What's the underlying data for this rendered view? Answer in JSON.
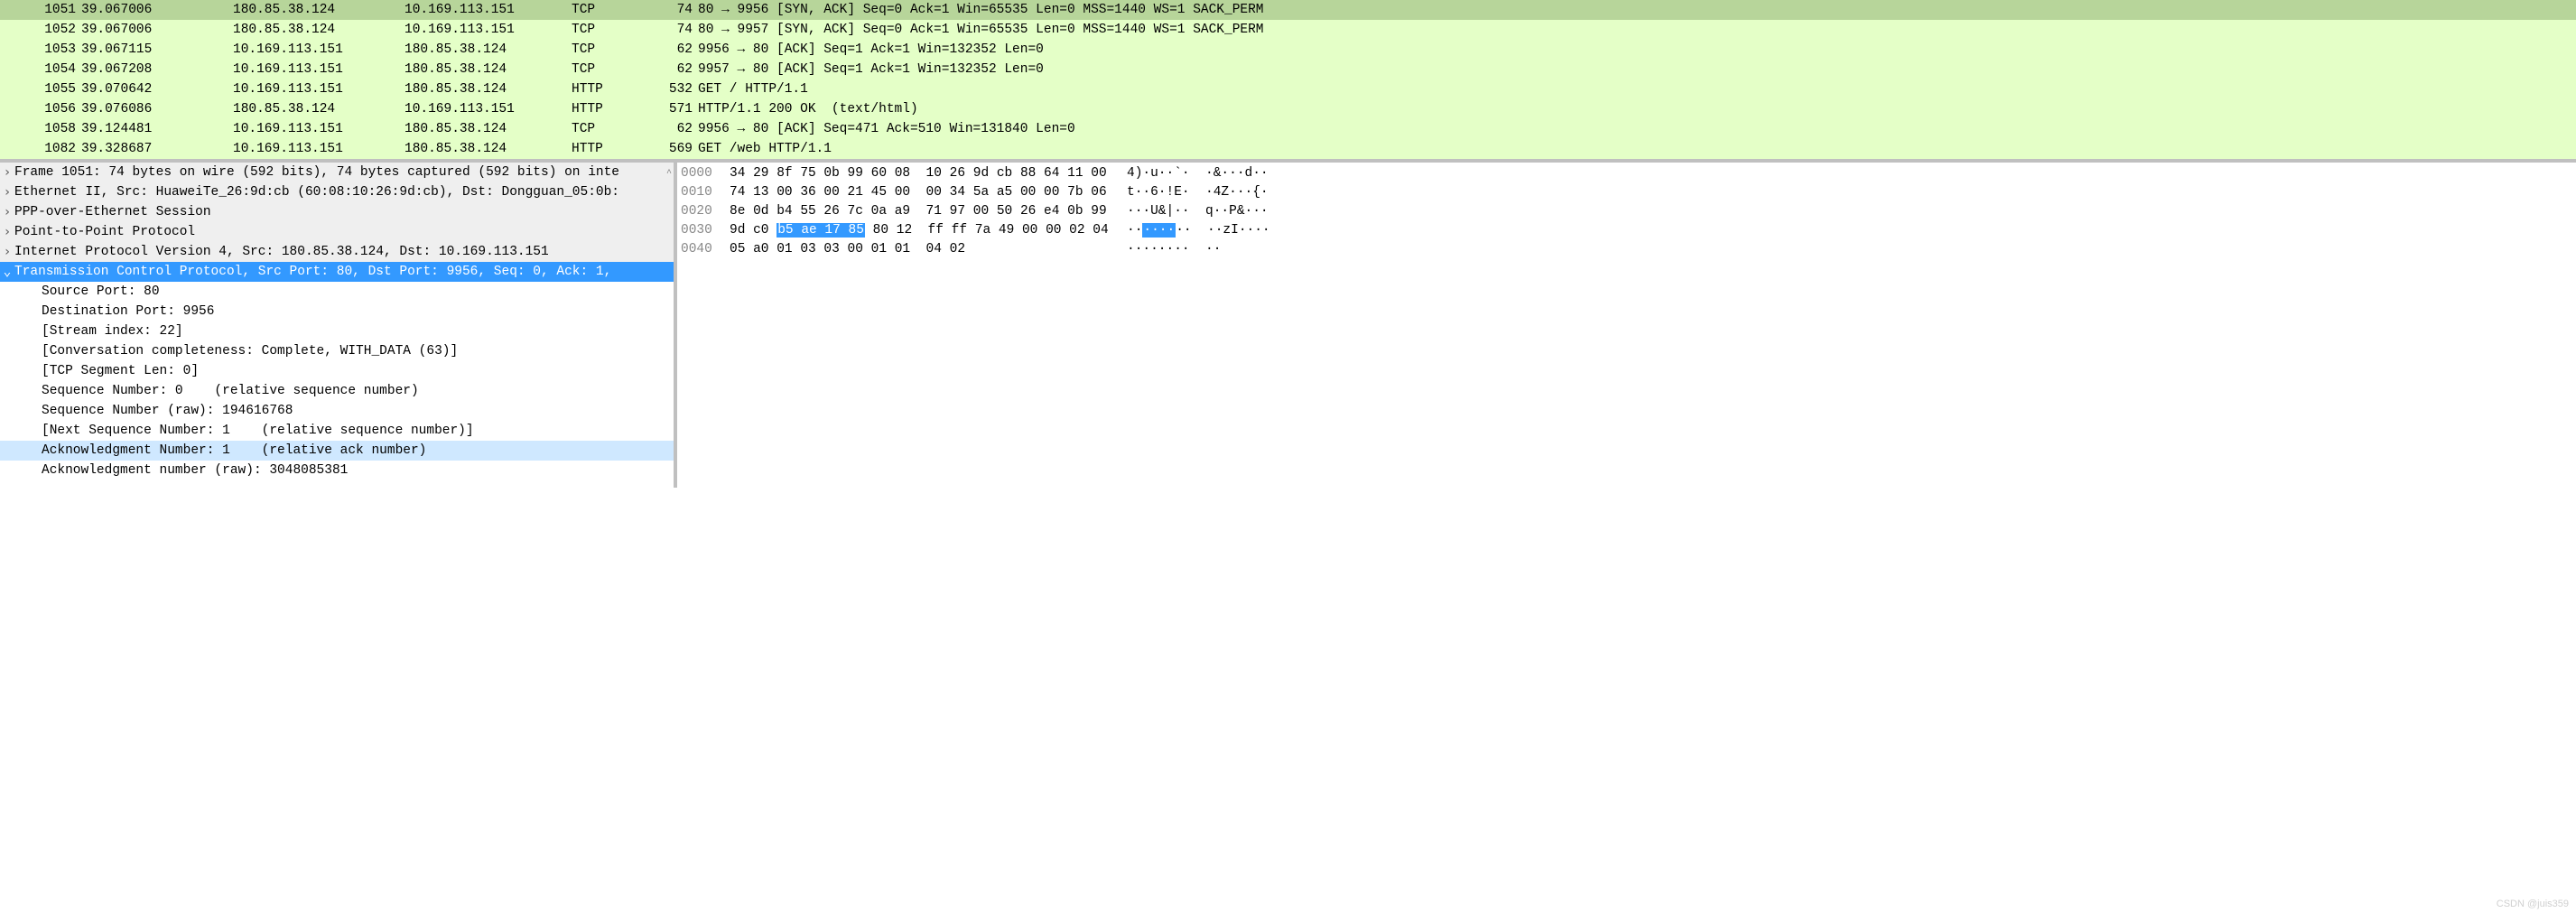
{
  "packets": [
    {
      "no": "1051",
      "time": "39.067006",
      "src": "180.85.38.124",
      "dst": "10.169.113.151",
      "proto": "TCP",
      "len": "74",
      "info": "80 → 9956 [SYN, ACK] Seq=0 Ack=1 Win=65535 Len=0 MSS=1440 WS=1 SACK_PERM",
      "selected": true
    },
    {
      "no": "1052",
      "time": "39.067006",
      "src": "180.85.38.124",
      "dst": "10.169.113.151",
      "proto": "TCP",
      "len": "74",
      "info": "80 → 9957 [SYN, ACK] Seq=0 Ack=1 Win=65535 Len=0 MSS=1440 WS=1 SACK_PERM"
    },
    {
      "no": "1053",
      "time": "39.067115",
      "src": "10.169.113.151",
      "dst": "180.85.38.124",
      "proto": "TCP",
      "len": "62",
      "info": "9956 → 80 [ACK] Seq=1 Ack=1 Win=132352 Len=0"
    },
    {
      "no": "1054",
      "time": "39.067208",
      "src": "10.169.113.151",
      "dst": "180.85.38.124",
      "proto": "TCP",
      "len": "62",
      "info": "9957 → 80 [ACK] Seq=1 Ack=1 Win=132352 Len=0"
    },
    {
      "no": "1055",
      "time": "39.070642",
      "src": "10.169.113.151",
      "dst": "180.85.38.124",
      "proto": "HTTP",
      "len": "532",
      "info": "GET / HTTP/1.1"
    },
    {
      "no": "1056",
      "time": "39.076086",
      "src": "180.85.38.124",
      "dst": "10.169.113.151",
      "proto": "HTTP",
      "len": "571",
      "info": "HTTP/1.1 200 OK  (text/html)"
    },
    {
      "no": "1058",
      "time": "39.124481",
      "src": "10.169.113.151",
      "dst": "180.85.38.124",
      "proto": "TCP",
      "len": "62",
      "info": "9956 → 80 [ACK] Seq=471 Ack=510 Win=131840 Len=0"
    },
    {
      "no": "1082",
      "time": "39.328687",
      "src": "10.169.113.151",
      "dst": "180.85.38.124",
      "proto": "HTTP",
      "len": "569",
      "info": "GET /web HTTP/1.1"
    }
  ],
  "tree": {
    "frame": "Frame 1051: 74 bytes on wire (592 bits), 74 bytes captured (592 bits) on inte",
    "eth": "Ethernet II, Src: HuaweiTe_26:9d:cb (60:08:10:26:9d:cb), Dst: Dongguan_05:0b:",
    "ppoe": "PPP-over-Ethernet Session",
    "ppp": "Point-to-Point Protocol",
    "ip": "Internet Protocol Version 4, Src: 180.85.38.124, Dst: 10.169.113.151",
    "tcp": "Transmission Control Protocol, Src Port: 80, Dst Port: 9956, Seq: 0, Ack: 1, ",
    "children": [
      "Source Port: 80",
      "Destination Port: 9956",
      "[Stream index: 22]",
      "[Conversation completeness: Complete, WITH_DATA (63)]",
      "[TCP Segment Len: 0]",
      "Sequence Number: 0    (relative sequence number)",
      "Sequence Number (raw): 194616768",
      "[Next Sequence Number: 1    (relative sequence number)]",
      "Acknowledgment Number: 1    (relative ack number)",
      "Acknowledgment number (raw): 3048085381"
    ],
    "highlight_child_index": 8
  },
  "hex": {
    "rows": [
      {
        "off": "0000",
        "b": "34 29 8f 75 0b 99 60 08  10 26 9d cb 88 64 11 00",
        "a": "4)·u··`·  ·&···d··"
      },
      {
        "off": "0010",
        "b": "74 13 00 36 00 21 45 00  00 34 5a a5 00 00 7b 06",
        "a": "t··6·!E·  ·4Z···{·"
      },
      {
        "off": "0020",
        "b": "8e 0d b4 55 26 7c 0a a9  71 97 00 50 26 e4 0b 99",
        "a": "···U&|··  q··P&···"
      },
      {
        "off": "0030",
        "b_pre": "9d c0 ",
        "b_hl": "b5 ae 17 85",
        "b_post": " 80 12  ff ff 7a 49 00 00 02 04",
        "a_pre": "··",
        "a_hl": "····",
        "a_post": "··  ··zI····"
      },
      {
        "off": "0040",
        "b": "05 a0 01 03 03 00 01 01  04 02",
        "a": "········  ··"
      }
    ]
  },
  "glyph": {
    "collapsed": "›",
    "expanded": "⌄"
  },
  "watermark": "CSDN @juis359"
}
